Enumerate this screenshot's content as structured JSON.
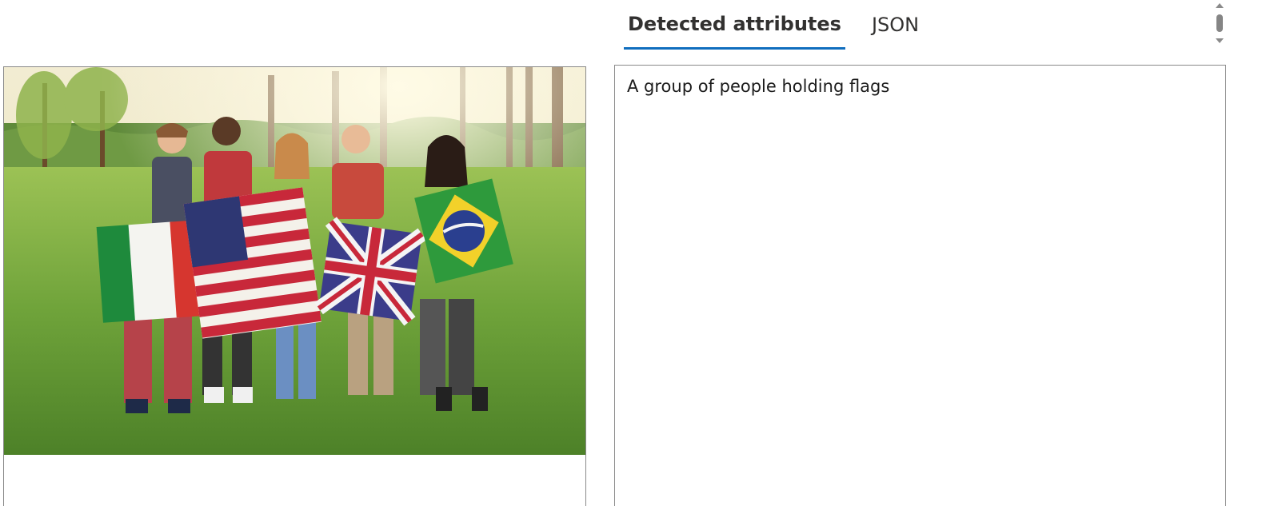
{
  "tabs": [
    {
      "label": "Detected attributes",
      "active": true
    },
    {
      "label": "JSON",
      "active": false
    }
  ],
  "result": {
    "caption": "A group of people holding flags"
  },
  "image": {
    "description_icon": "photo-image",
    "flags": [
      "Italy",
      "United States",
      "United Kingdom",
      "Brazil"
    ]
  },
  "colors": {
    "tab_active_underline": "#106ebe",
    "border": "#8a8a8a"
  }
}
